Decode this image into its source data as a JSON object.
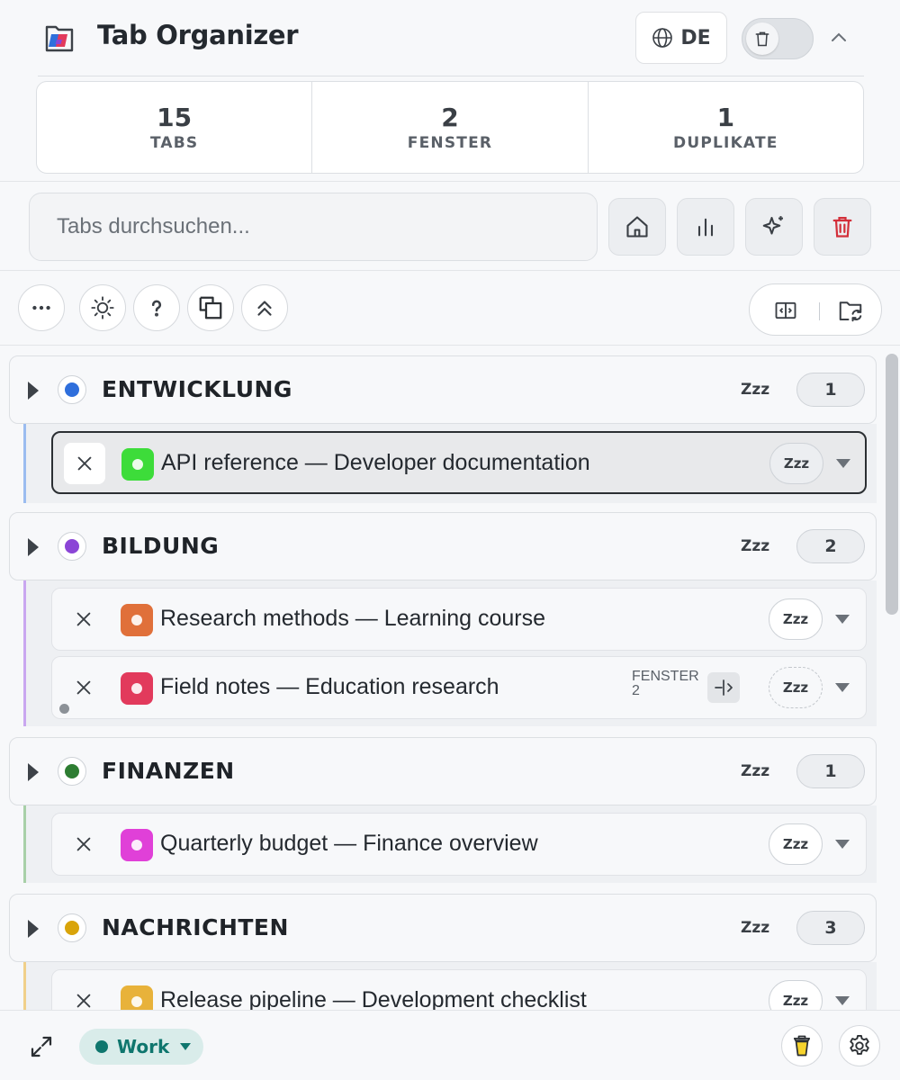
{
  "app": {
    "title": "Tab Organizer",
    "language": "DE"
  },
  "stats": [
    {
      "value": "15",
      "label": "TABS"
    },
    {
      "value": "2",
      "label": "FENSTER"
    },
    {
      "value": "1",
      "label": "DUPLIKATE"
    }
  ],
  "search": {
    "placeholder": "Tabs durchsuchen..."
  },
  "groups": [
    {
      "name": "ENTWICKLUNG",
      "color": "#2f6fdc",
      "count": "1",
      "snooze": "Zzz",
      "tabs": [
        {
          "title": "API reference — Developer documentation",
          "favicon_color": "#3ddc3a",
          "snooze": "Zzz",
          "active": true
        }
      ]
    },
    {
      "name": "BILDUNG",
      "color": "#8b45d6",
      "count": "2",
      "snooze": "Zzz",
      "tabs": [
        {
          "title": "Research methods — Learning course",
          "favicon_color": "#e0703a",
          "snooze": "Zzz"
        },
        {
          "title": "Field notes — Education research",
          "favicon_color": "#e23a5c",
          "snooze": "Zzz",
          "window_label": "FENSTER",
          "window_number": "2"
        }
      ]
    },
    {
      "name": "FINANZEN",
      "color": "#2e7d32",
      "count": "1",
      "snooze": "Zzz",
      "tabs": [
        {
          "title": "Quarterly budget — Finance overview",
          "favicon_color": "#e040d8",
          "snooze": "Zzz"
        }
      ]
    },
    {
      "name": "NACHRICHTEN",
      "color": "#d9a40a",
      "count": "3",
      "snooze": "Zzz",
      "tabs": [
        {
          "title": "Release pipeline — Development checklist",
          "favicon_color": "#e8b23a",
          "snooze": "Zzz"
        }
      ]
    }
  ],
  "footer": {
    "workspace": "Work",
    "workspace_color": "#0f766e"
  }
}
